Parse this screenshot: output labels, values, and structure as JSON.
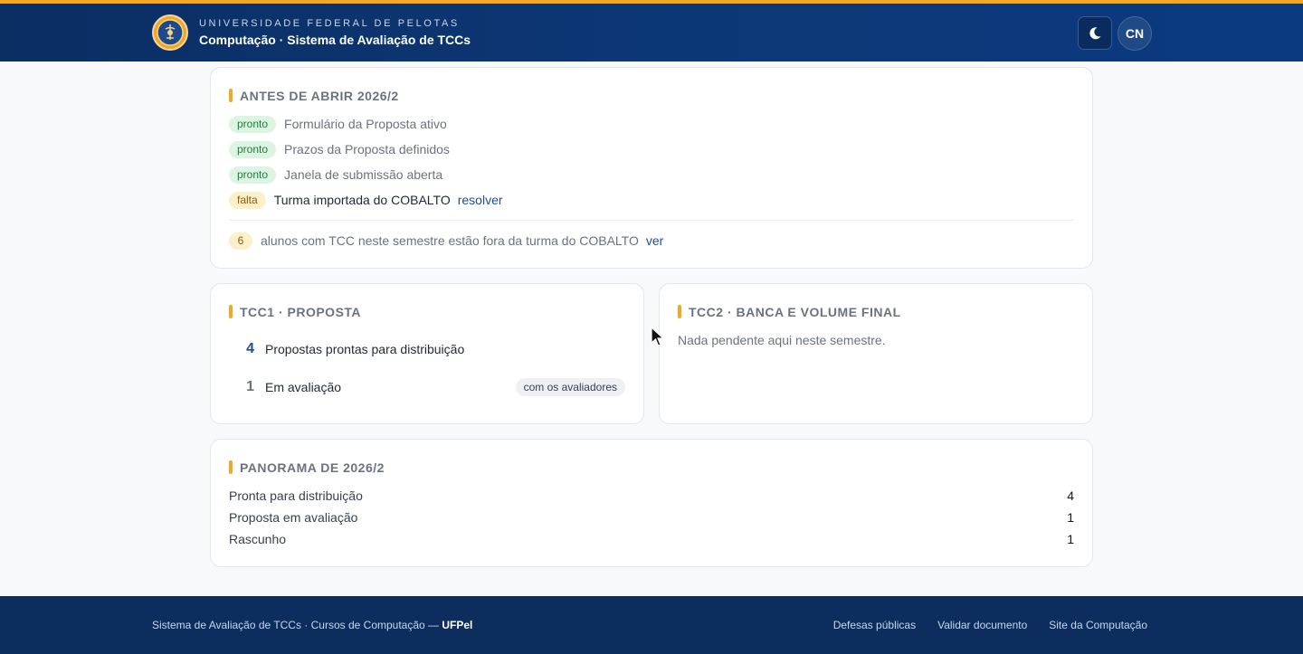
{
  "header": {
    "university": "UNIVERSIDADE FEDERAL DE PELOTAS",
    "system": "Computação · Sistema de Avaliação de TCCs",
    "theme_icon": "moon-icon",
    "avatar_initials": "CN"
  },
  "checklist": {
    "title": "ANTES DE ABRIR 2026/2",
    "items": [
      {
        "status": "pronto",
        "text": "Formulário da Proposta ativo"
      },
      {
        "status": "pronto",
        "text": "Prazos da Proposta definidos"
      },
      {
        "status": "pronto",
        "text": "Janela de submissão aberta"
      },
      {
        "status": "falta",
        "text": "Turma importada do COBALTO",
        "action": "resolver"
      }
    ],
    "warning": {
      "count": "6",
      "text": "alunos com TCC neste semestre estão fora da turma do COBALTO",
      "action": "ver"
    }
  },
  "tcc1": {
    "title": "TCC1 · PROPOSTA",
    "rows": [
      {
        "count": "4",
        "label": "Propostas prontas para distribuição"
      },
      {
        "count": "1",
        "label": "Em avaliação",
        "tag": "com os avaliadores"
      }
    ]
  },
  "tcc2": {
    "title": "TCC2 · BANCA E VOLUME FINAL",
    "empty": "Nada pendente aqui neste semestre."
  },
  "panorama": {
    "title": "PANORAMA DE 2026/2",
    "rows": [
      {
        "label": "Pronta para distribuição",
        "value": "4"
      },
      {
        "label": "Proposta em avaliação",
        "value": "1"
      },
      {
        "label": "Rascunho",
        "value": "1"
      }
    ]
  },
  "footer": {
    "text": "Sistema de Avaliação de TCCs · Cursos de Computação — ",
    "brand": "UFPel",
    "links": [
      "Defesas públicas",
      "Validar documento",
      "Site da Computação"
    ]
  },
  "colors": {
    "accent": "#f5a623",
    "header": "#0c3775",
    "link": "#1d4e9a"
  }
}
